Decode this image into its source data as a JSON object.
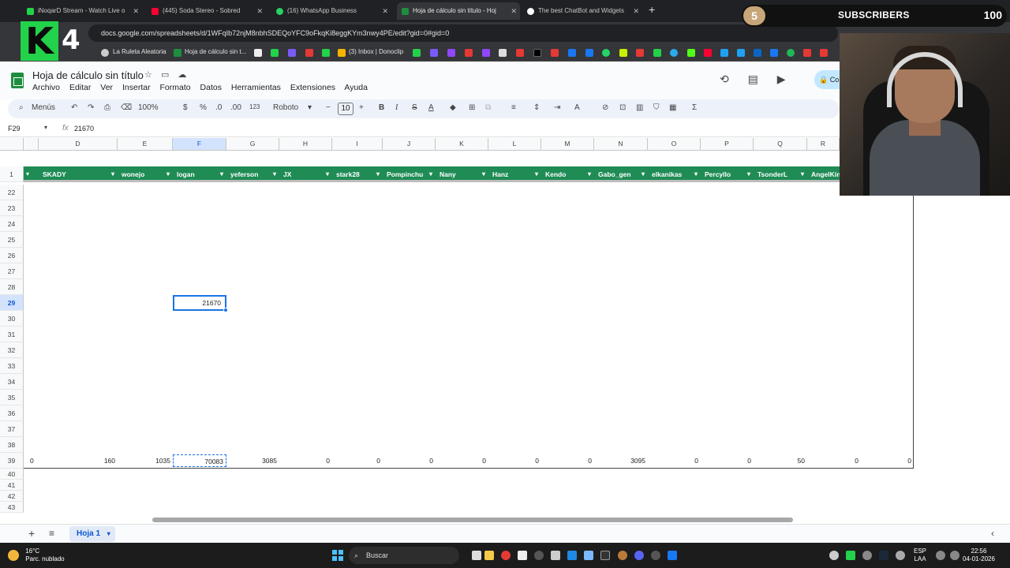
{
  "browser": {
    "tabs": [
      {
        "title": "iNoqarD Stream - Watch Live o",
        "color": "#22d24a"
      },
      {
        "title": "(445) Soda Stereo - Sobred",
        "color": "#ff0033"
      },
      {
        "title": "(16) WhatsApp Business",
        "color": "#25d366"
      },
      {
        "title": "Hoja de cálculo sin título - Hoj",
        "color": "#1e8e3e"
      },
      {
        "title": "The best ChatBot and Widgets",
        "color": "#ffffff"
      }
    ],
    "url": "docs.google.com/spreadsheets/d/1WFqIb72njM8nbhSDEQoYFC9oFkqKi8eggKYm3nwy4PE/edit?gid=0#gid=0",
    "bookmarks": [
      "La Ruleta Aleatoria",
      "Hoja de cálculo sin t...",
      "(3) Inbox | Donoclip"
    ]
  },
  "overlay": {
    "logo_letter": "K",
    "logo_number": "4",
    "subscribers_label": "SUBSCRIBERS",
    "subscribers_badge": "5",
    "subscribers_count": "100"
  },
  "sheets": {
    "title": "Hoja de cálculo sin título",
    "menu": [
      "Archivo",
      "Editar",
      "Ver",
      "Insertar",
      "Formato",
      "Datos",
      "Herramientas",
      "Extensiones",
      "Ayuda"
    ],
    "share_label": "Co",
    "toolbar": {
      "menus_label": "Menús",
      "zoom": "100%",
      "currency": "$",
      "percent": "%",
      "dec_minus": ".0",
      "dec_plus": ".00",
      "number_format": "123",
      "font": "Roboto",
      "font_size": "10",
      "bold": "B",
      "italic": "I",
      "underline": "A",
      "sigma": "Σ"
    },
    "name_box": "F29",
    "formula_value": "21670",
    "columns": [
      "D",
      "E",
      "F",
      "G",
      "H",
      "I",
      "J",
      "K",
      "L",
      "M",
      "N",
      "O",
      "P",
      "Q",
      "R"
    ],
    "selected_column": "F",
    "header_row_number": "1",
    "players": [
      "SKADY",
      "wonejo",
      "logan",
      "yeferson",
      "JX",
      "stark28",
      "Pompinchu",
      "Nany",
      "Hanz",
      "Kendo",
      "Gabo_gen",
      "elkanikas",
      "Percyllo",
      "TsonderL",
      "AngelKin"
    ],
    "rows": [
      "22",
      "23",
      "24",
      "25",
      "26",
      "27",
      "28",
      "29",
      "30",
      "31",
      "32",
      "33",
      "34",
      "35",
      "36",
      "37",
      "38",
      "39",
      "40",
      "41",
      "42",
      "43"
    ],
    "selected_row": "29",
    "selected_value": "21670",
    "totals_row": [
      "0",
      "160",
      "1035",
      "70083",
      "3085",
      "0",
      "0",
      "0",
      "0",
      "0",
      "0",
      "3095",
      "0",
      "0",
      "50",
      "0",
      "0"
    ],
    "sheet_tab": "Hoja 1"
  },
  "taskbar": {
    "temperature": "16°C",
    "weather": "Parc. nublado",
    "search": "Buscar",
    "lang_top": "ESP",
    "lang_bottom": "LAA",
    "time": "22:56",
    "date": "04-01-2026"
  },
  "colors": {
    "header_green": "#1f8c55",
    "selection_blue": "#1a73e8",
    "logo_green": "#22d24a"
  }
}
